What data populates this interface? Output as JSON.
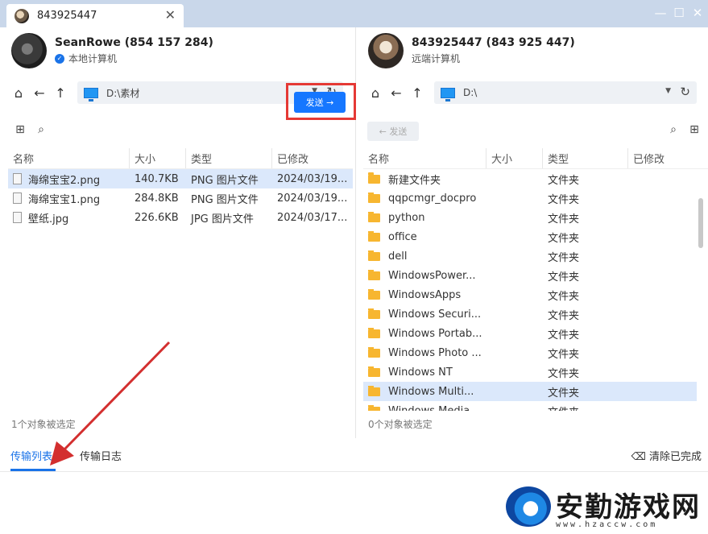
{
  "window": {
    "tab_title": "843925447",
    "tab_close": "✕",
    "controls": {
      "minimize": "—",
      "maximize": "☐",
      "close": "✕"
    }
  },
  "left": {
    "user_name": "SeanRowe (854 157 284)",
    "user_sub": "本地计算机",
    "path": "D:\\素材",
    "send_label": "发送 →",
    "columns": [
      "名称",
      "大小",
      "类型",
      "已修改"
    ],
    "files": [
      {
        "name": "海绵宝宝2.png",
        "size": "140.7KB",
        "type": "PNG 图片文件",
        "modified": "2024/03/19..."
      },
      {
        "name": "海绵宝宝1.png",
        "size": "284.8KB",
        "type": "PNG 图片文件",
        "modified": "2024/03/19..."
      },
      {
        "name": "壁纸.jpg",
        "size": "226.6KB",
        "type": "JPG 图片文件",
        "modified": "2024/03/17..."
      }
    ],
    "status": "1个对象被选定"
  },
  "right": {
    "user_name": "843925447 (843 925 447)",
    "user_sub": "远端计算机",
    "path": "D:\\",
    "send_label": "← 发送",
    "columns": [
      "名称",
      "大小",
      "类型",
      "已修改"
    ],
    "folders": [
      {
        "name": "新建文件夹",
        "type": "文件夹"
      },
      {
        "name": "qqpcmgr_docpro",
        "type": "文件夹"
      },
      {
        "name": "python",
        "type": "文件夹"
      },
      {
        "name": "office",
        "type": "文件夹"
      },
      {
        "name": "dell",
        "type": "文件夹"
      },
      {
        "name": "WindowsPower...",
        "type": "文件夹"
      },
      {
        "name": "WindowsApps",
        "type": "文件夹"
      },
      {
        "name": "Windows Securi...",
        "type": "文件夹"
      },
      {
        "name": "Windows Portab...",
        "type": "文件夹"
      },
      {
        "name": "Windows Photo ...",
        "type": "文件夹"
      },
      {
        "name": "Windows NT",
        "type": "文件夹"
      },
      {
        "name": "Windows Multi...",
        "type": "文件夹"
      },
      {
        "name": "Windows Media",
        "type": "文件夹"
      }
    ],
    "status": "0个对象被选定"
  },
  "bottom": {
    "tab_transfer_list": "传输列表",
    "tab_transfer_log": "传输日志",
    "clear_done": "清除已完成"
  },
  "watermark": {
    "text": "安勤游戏网",
    "url": "www.hzaccw.com"
  },
  "colors": {
    "accent": "#1677ff",
    "highlight_box": "#e53935",
    "annotation_arrow": "#d32f2f",
    "selection": "#dbe8fb",
    "folder": "#f7b630"
  }
}
